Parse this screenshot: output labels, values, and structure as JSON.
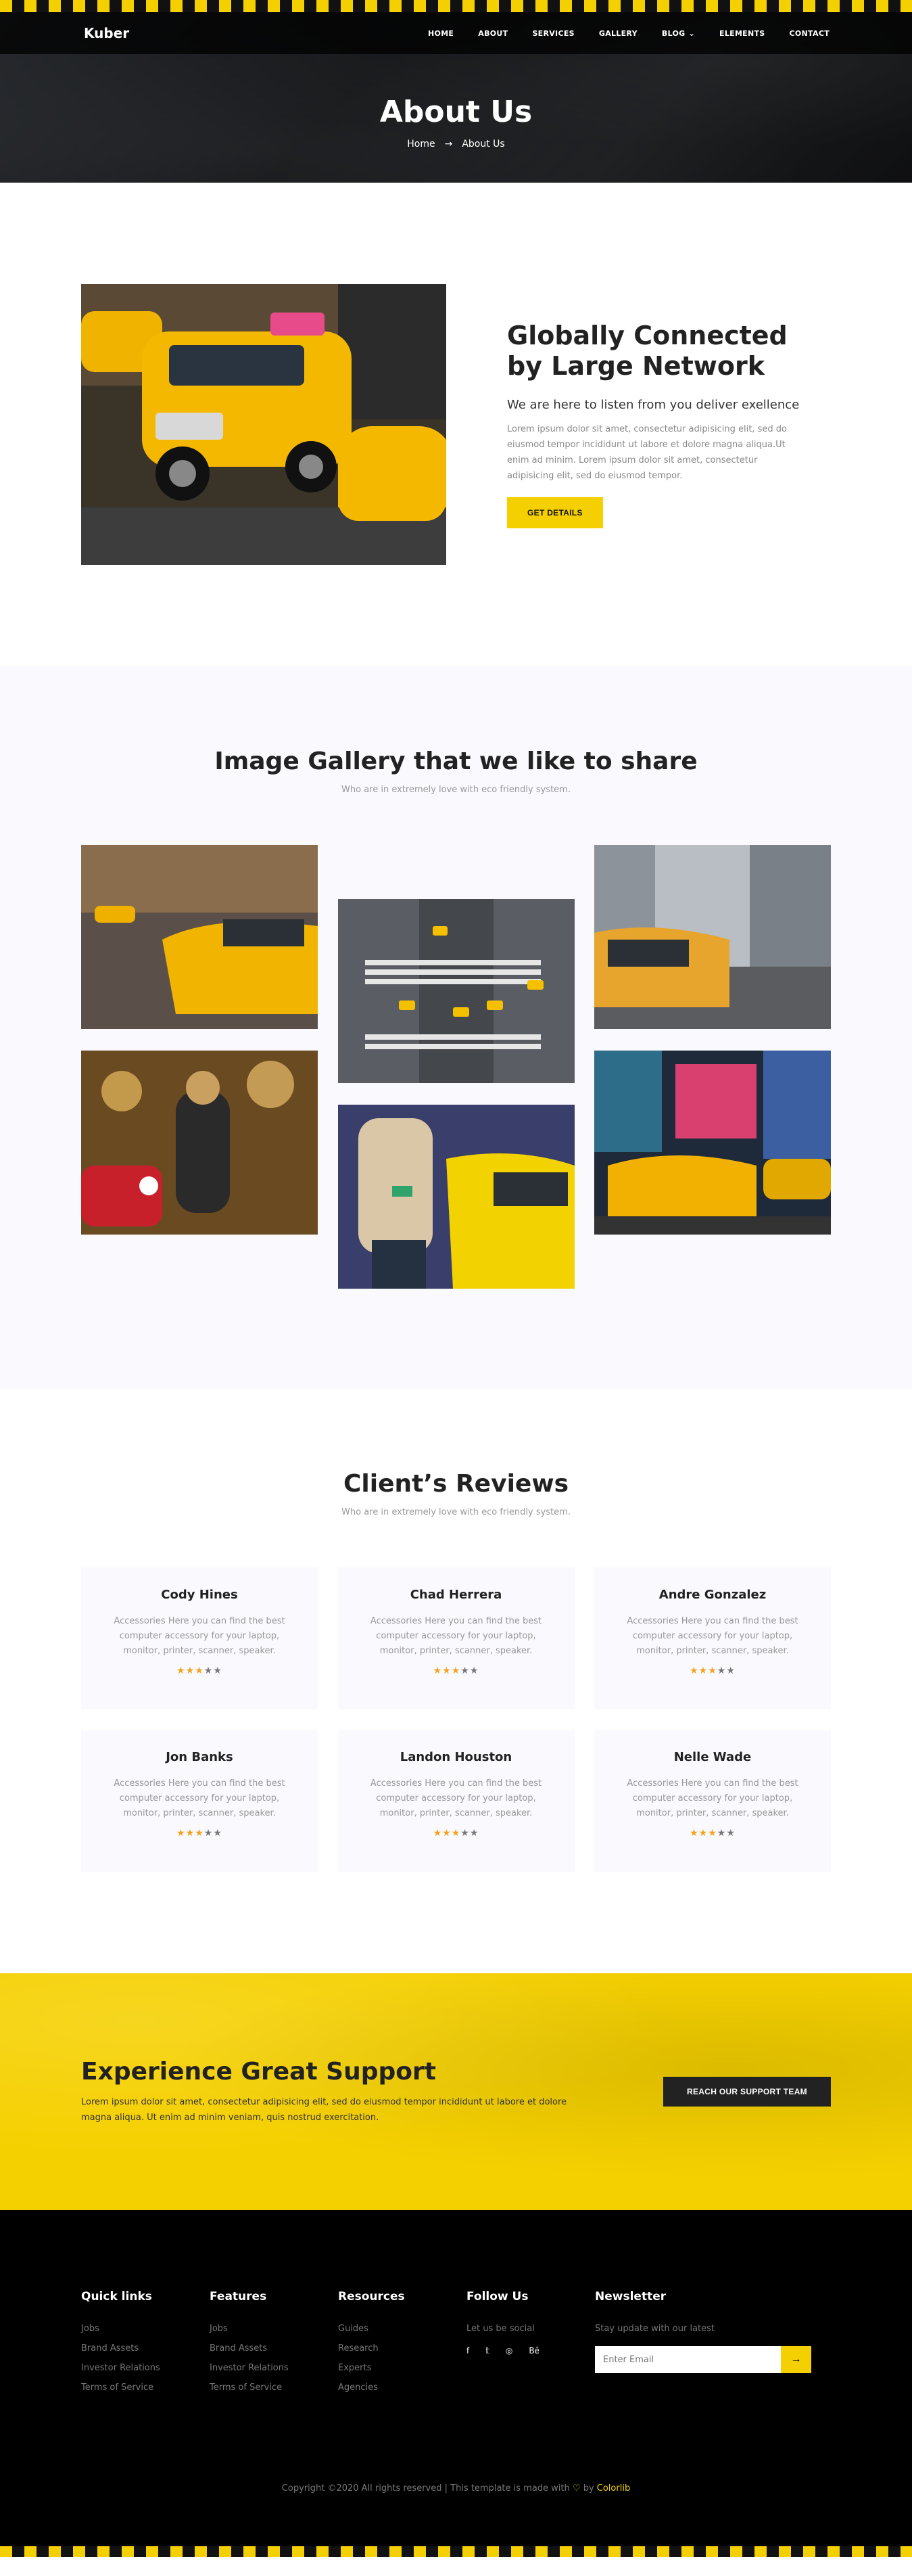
{
  "brand": {
    "logo": "Kuber",
    "accent": "#f5d000",
    "dark": "#222222"
  },
  "nav": {
    "items": [
      "HOME",
      "ABOUT",
      "SERVICES",
      "GALLERY",
      "BLOG",
      "ELEMENTS",
      "CONTACT"
    ],
    "blog_caret_icon": "chevron-down-icon"
  },
  "hero": {
    "title": "About Us",
    "crumb_home": "Home",
    "crumb_current": "About Us",
    "crumb_arrow": "→"
  },
  "about": {
    "title": "Globally Connected by Large Network",
    "subtitle": "We are here to listen from you deliver exellence",
    "body": "Lorem ipsum dolor sit amet, consectetur adipisicing elit, sed do eiusmod tempor incididunt ut labore et dolore magna aliqua.Ut enim ad minim. Lorem ipsum dolor sit amet, consectetur adipisicing elit, sed do eiusmod tempor.",
    "button": "GET DETAILS"
  },
  "gallery": {
    "title": "Image Gallery that we like to share",
    "subtitle": "Who are in extremely love with eco friendly system."
  },
  "reviews": {
    "title": "Client’s Reviews",
    "subtitle": "Who are in extremely love with eco friendly system.",
    "items": [
      {
        "name": "Cody Hines",
        "text": "Accessories Here you can find the best computer accessory for your laptop, monitor, printer, scanner, speaker.",
        "stars": 3
      },
      {
        "name": "Chad Herrera",
        "text": "Accessories Here you can find the best computer accessory for your laptop, monitor, printer, scanner, speaker.",
        "stars": 3
      },
      {
        "name": "Andre Gonzalez",
        "text": "Accessories Here you can find the best computer accessory for your laptop, monitor, printer, scanner, speaker.",
        "stars": 3
      },
      {
        "name": "Jon Banks",
        "text": "Accessories Here you can find the best computer accessory for your laptop, monitor, printer, scanner, speaker.",
        "stars": 3
      },
      {
        "name": "Landon Houston",
        "text": "Accessories Here you can find the best computer accessory for your laptop, monitor, printer, scanner, speaker.",
        "stars": 3
      },
      {
        "name": "Nelle Wade",
        "text": "Accessories Here you can find the best computer accessory for your laptop, monitor, printer, scanner, speaker.",
        "stars": 3
      }
    ]
  },
  "support": {
    "title": "Experience Great Support",
    "body": "Lorem ipsum dolor sit amet, consectetur adipisicing elit, sed do eiusmod tempor incididunt ut labore et dolore magna aliqua. Ut enim ad minim veniam, quis nostrud exercitation.",
    "button": "REACH OUR SUPPORT TEAM"
  },
  "footer": {
    "quick_links": {
      "title": "Quick links",
      "items": [
        "Jobs",
        "Brand Assets",
        "Investor Relations",
        "Terms of Service"
      ]
    },
    "features": {
      "title": "Features",
      "items": [
        "Jobs",
        "Brand Assets",
        "Investor Relations",
        "Terms of Service"
      ]
    },
    "resources": {
      "title": "Resources",
      "items": [
        "Guides",
        "Research",
        "Experts",
        "Agencies"
      ]
    },
    "follow": {
      "title": "Follow Us",
      "text": "Let us be social",
      "icons": [
        "f",
        "𝕥",
        "◎",
        "Bē"
      ]
    },
    "newsletter": {
      "title": "Newsletter",
      "text": "Stay update with our latest",
      "placeholder": "Enter Email",
      "button": "→"
    },
    "copyright_pre": "Copyright ©2020 All rights reserved | This template is made with",
    "copyright_by": "by",
    "copyright_brand": "Colorlib"
  }
}
